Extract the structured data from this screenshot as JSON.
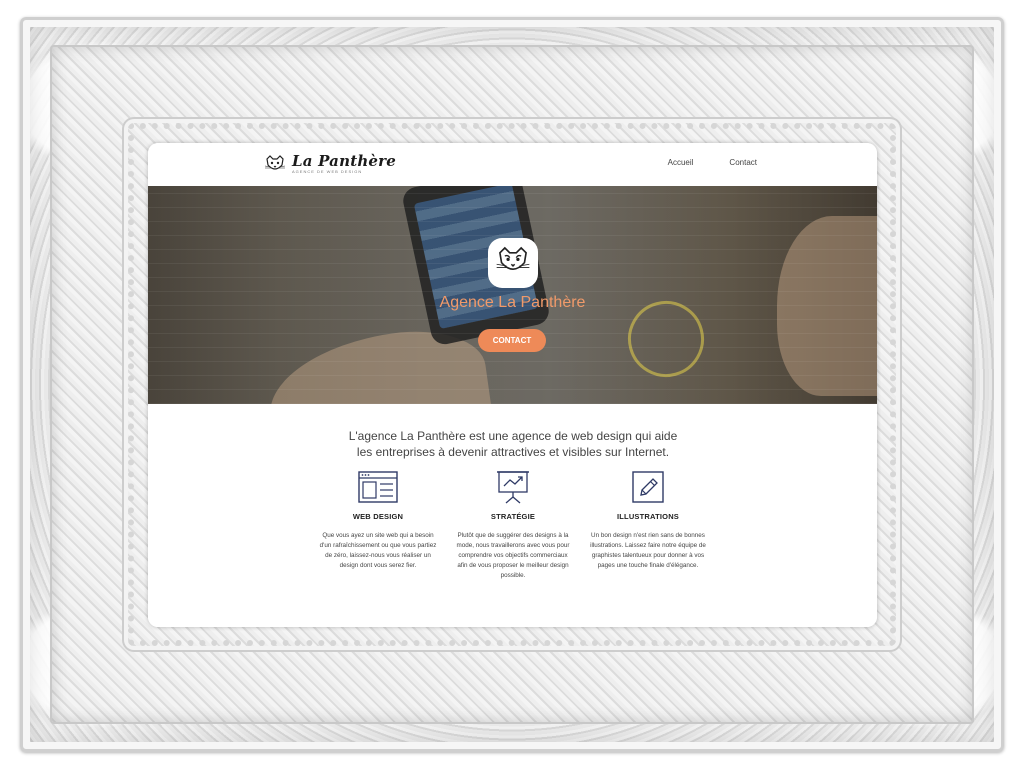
{
  "nav": {
    "brand": "La Panthère",
    "brand_sub": "AGENCE DE WEB DESIGN",
    "links": [
      "Accueil",
      "Contact"
    ]
  },
  "hero": {
    "title": "Agence La Panthère",
    "button": "CONTACT"
  },
  "intro": "L'agence La Panthère est une agence de web design qui aide les entreprises à devenir attractives et visibles sur Internet.",
  "services": [
    {
      "icon": "browser-layout-icon",
      "title": "WEB DESIGN",
      "desc": "Que vous ayez un site web qui a besoin d'un rafraîchissement ou que vous partiez de zéro, laissez-nous vous réaliser un design dont vous serez fier."
    },
    {
      "icon": "presentation-chart-icon",
      "title": "STRATÉGIE",
      "desc": "Plutôt que de suggérer des designs à la mode, nous travaillerons avec vous pour comprendre vos objectifs commerciaux afin de vous proposer le meilleur design possible."
    },
    {
      "icon": "pencil-edit-icon",
      "title": "ILLUSTRATIONS",
      "desc": "Un bon design n'est rien sans de bonnes illustrations. Laissez faire notre équipe de graphistes talentueux pour donner à vos pages une touche finale d'élégance."
    }
  ],
  "colors": {
    "accent": "#ee8a58",
    "hero_title": "#f09a6a",
    "icon": "#2f3a66"
  }
}
